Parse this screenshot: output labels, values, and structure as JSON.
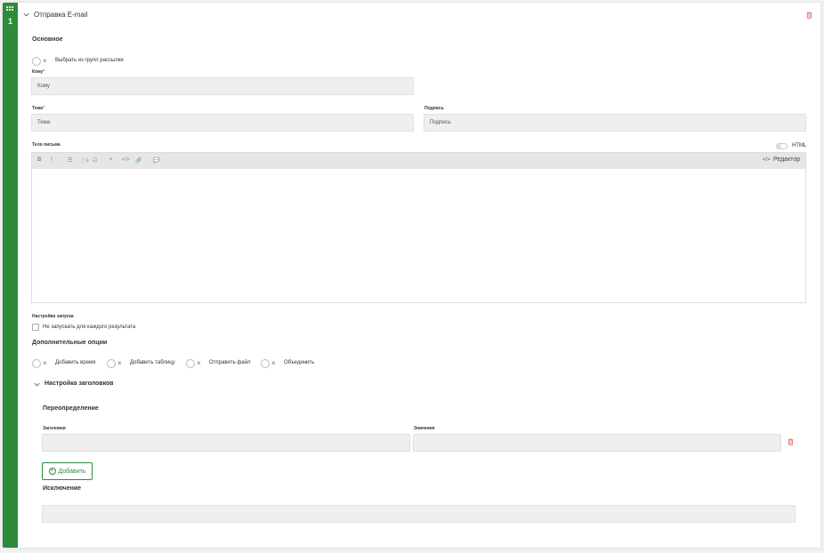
{
  "step": {
    "number": "1"
  },
  "header": {
    "title": "Отправка E-mail"
  },
  "main": {
    "section_title": "Основное",
    "toggle_groups_label": "Выбрать из групп рассылки",
    "to": {
      "label": "Кому",
      "placeholder": "Кому"
    },
    "subject": {
      "label": "Тема",
      "placeholder": "Тема"
    },
    "signature": {
      "label": "Подпись",
      "placeholder": "Подпись"
    },
    "body": {
      "label": "Тело письма",
      "html_toggle_label": "HTML",
      "editor_label": "Редактор"
    },
    "toolbar": {
      "bold": "B",
      "italic": "I",
      "bullet_list": "☰",
      "numbered_list": "⋮≡",
      "task_list": "☑",
      "quote": "❝",
      "code": "</>",
      "link": "🔗",
      "comment": "💬",
      "editor_icon": "</>"
    },
    "launch": {
      "label": "Настройки запуска",
      "checkbox_label": "Не запускать для каждого результата"
    },
    "extra": {
      "title": "Дополнительные опции",
      "options": [
        "Добавить время",
        "Добавить таблицу",
        "Отправить файл",
        "Объединить"
      ]
    },
    "headers": {
      "title": "Настройка заголовков",
      "override_title": "Переопределение",
      "headers_label": "Заголовки",
      "values_label": "Значения",
      "add_label": "Добавить",
      "exclusion_title": "Исключение"
    }
  },
  "colors": {
    "accent": "#2e8b3a",
    "danger": "#d9534f",
    "input_bg": "#efefef"
  }
}
